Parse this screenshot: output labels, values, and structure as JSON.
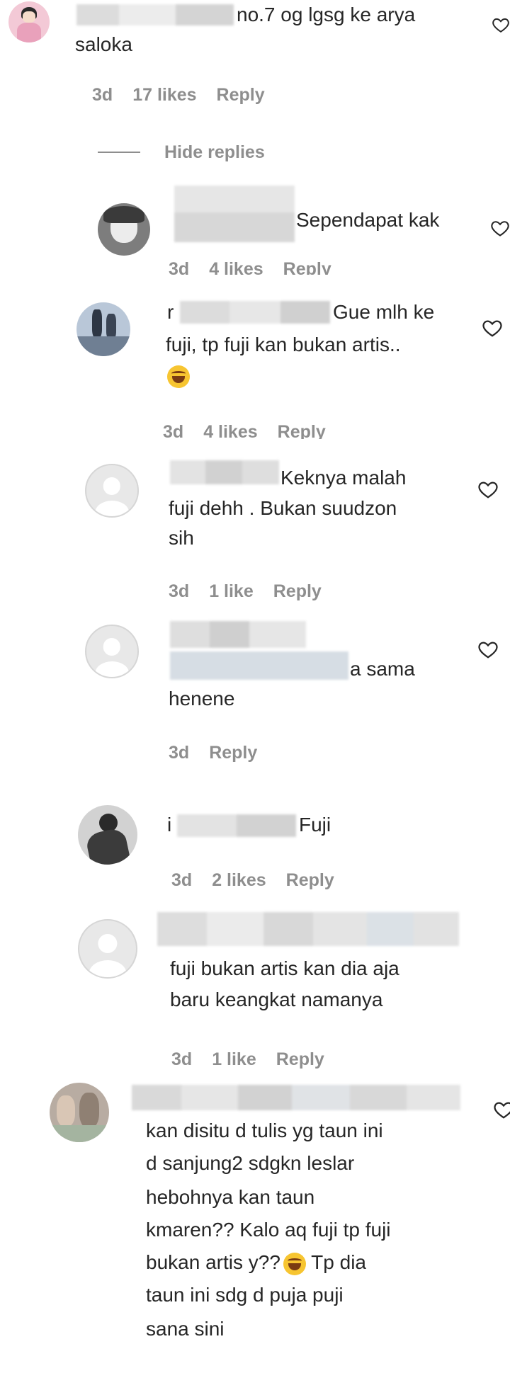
{
  "comments": [
    {
      "id": "c1",
      "text_line1": "no.7 og lgsg ke arya",
      "text_line2": "saloka",
      "time": "3d",
      "likes": "17 likes",
      "reply": "Reply"
    },
    {
      "id": "c2",
      "text_line1": "Sependapat kak",
      "time": "3d",
      "likes": "4 likes",
      "reply": "Reply"
    },
    {
      "id": "c3",
      "prefix": "r",
      "text_line1": "Gue mlh ke",
      "text_line2": "fuji, tp fuji kan bukan artis..",
      "emoji": "joy-emoji",
      "time": "3d",
      "likes": "4 likes",
      "reply": "Reply"
    },
    {
      "id": "c4",
      "text_line1": "Keknya malah",
      "text_line2": "fuji dehh . Bukan suudzon",
      "text_line3": "sih",
      "time": "3d",
      "likes": "1 like",
      "reply": "Reply"
    },
    {
      "id": "c5",
      "text_line1": "a sama",
      "text_line2": "henene",
      "time": "3d",
      "reply": "Reply"
    },
    {
      "id": "c6",
      "prefix": "i",
      "text_line1": "Fuji",
      "time": "3d",
      "likes": "2 likes",
      "reply": "Reply"
    },
    {
      "id": "c7",
      "text_line1": "fuji bukan artis kan dia aja",
      "text_line2": "baru keangkat namanya",
      "time": "3d",
      "likes": "1 like",
      "reply": "Reply"
    },
    {
      "id": "c8",
      "text_line1": "kan disitu d tulis yg taun ini",
      "text_line2": "d sanjung2 sdgkn leslar",
      "text_line3": "hebohnya kan taun",
      "text_line4": "kmaren?? Kalo aq fuji tp fuji",
      "text_line5": "bukan artis y??",
      "text_line5_after": "Tp dia",
      "text_line6": "taun ini sdg d puja puji",
      "text_line7": "sana sini"
    }
  ],
  "hide_replies": "Hide replies",
  "icons": {
    "like": "heart-outline-icon",
    "avatar_default": "default-avatar-icon"
  },
  "colors": {
    "text": "#262626",
    "meta": "#8e8e8e",
    "background": "#ffffff"
  }
}
